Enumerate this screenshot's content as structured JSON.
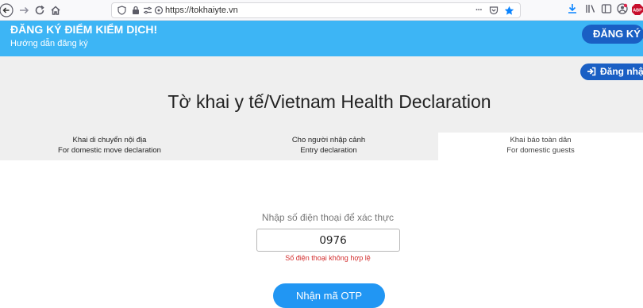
{
  "browser": {
    "url": "https://tokhaiyte.vn",
    "extension_badge": "ABP"
  },
  "banner": {
    "title": "ĐĂNG KÝ ĐIỂM KIỂM DỊCH!",
    "subtitle": "Hướng dẫn đăng ký",
    "register_label": "ĐĂNG KÝ"
  },
  "header": {
    "login_label": "Đăng nhập",
    "page_title": "Tờ khai y tế/Vietnam Health Declaration"
  },
  "tabs": [
    {
      "line1": "Khai di chuyển nội địa",
      "line2": "For domestic move declaration",
      "active": false
    },
    {
      "line1": "Cho người nhập cảnh",
      "line2": "Entry declaration",
      "active": false
    },
    {
      "line1": "Khai báo toàn dân",
      "line2": "For domestic guests",
      "active": true
    }
  ],
  "form": {
    "label": "Nhập số điện thoại để xác thực",
    "phone_value": "0976",
    "error": "Số điện thoại không hợp lệ",
    "otp_button": "Nhận mã OTP"
  },
  "colors": {
    "banner_bg": "#3db5f5",
    "button_dark": "#1a5fc4",
    "button_primary": "#2196f3",
    "error": "#d32f2f"
  }
}
